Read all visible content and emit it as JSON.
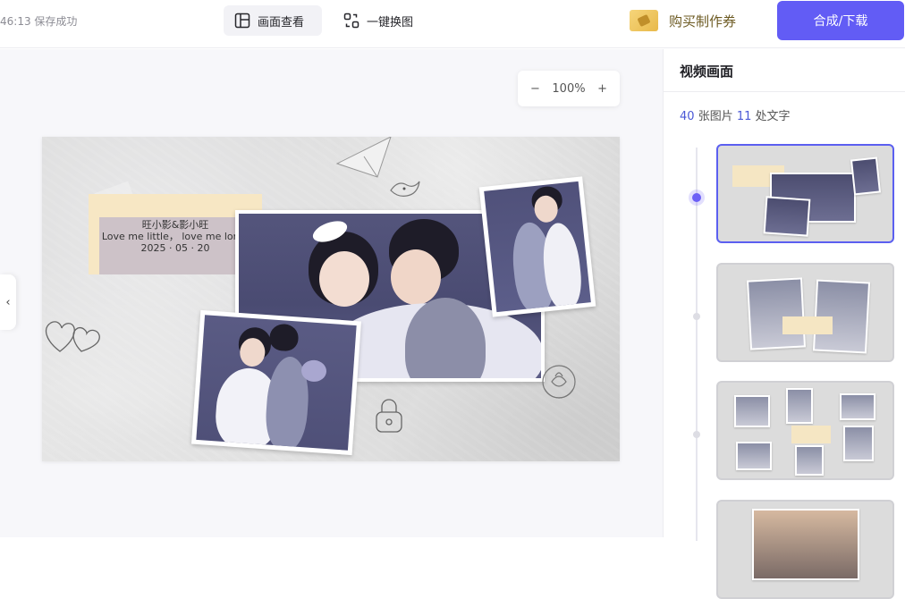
{
  "header": {
    "save_status": "46:13 保存成功",
    "tabs": [
      {
        "label": "画面查看",
        "icon": "layout-icon",
        "active": true
      },
      {
        "label": "一键换图",
        "icon": "swap-image-icon",
        "active": false
      }
    ],
    "coupon_label": "购买制作券",
    "primary_button": "合成/下载",
    "accent_color": "#625cf5"
  },
  "canvas": {
    "zoom": {
      "minus": "−",
      "value": "100%",
      "plus": "+"
    },
    "collapse_icon": "‹",
    "note": {
      "line1": "旺小影&影小旺",
      "line2": "Love me little，  love me long.",
      "line3": "2025 · 05 · 20"
    }
  },
  "sidebar": {
    "title": "视频画面",
    "stats": {
      "images_count": "40",
      "images_label": "张图片",
      "text_count": "11",
      "text_label": "处文字"
    },
    "thumbnails": [
      {
        "name": "scene-1",
        "active": true
      },
      {
        "name": "scene-2",
        "active": false
      },
      {
        "name": "scene-3",
        "active": false
      },
      {
        "name": "scene-4",
        "active": false
      }
    ]
  }
}
